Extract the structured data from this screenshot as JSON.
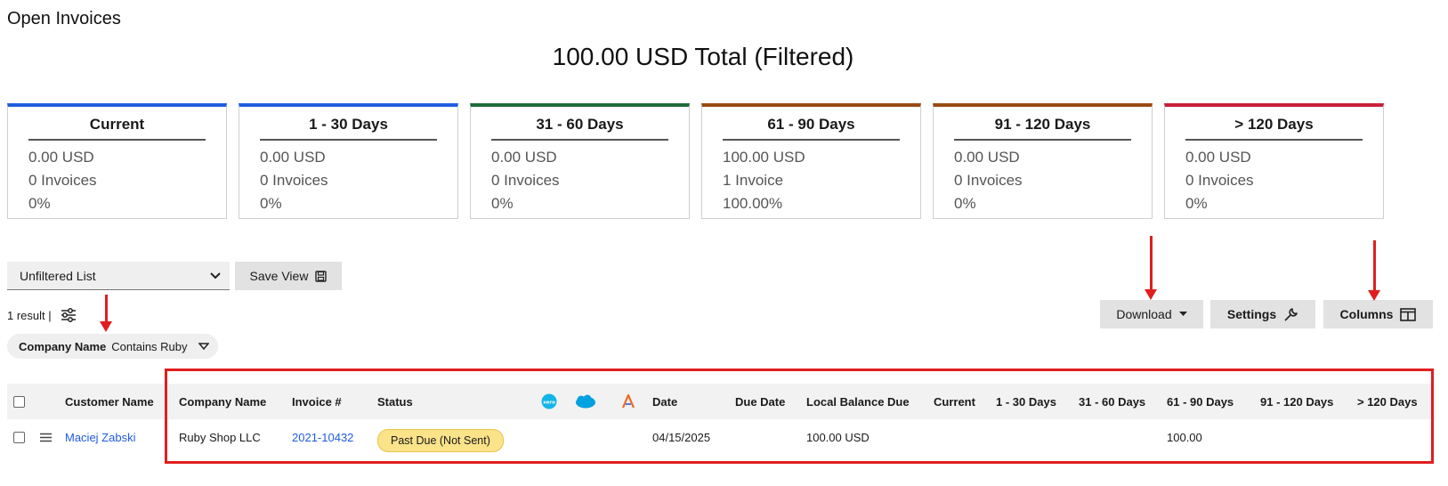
{
  "page": {
    "title": "Open Invoices",
    "total": "100.00 USD Total (Filtered)"
  },
  "buckets": [
    {
      "title": "Current",
      "amount": "0.00 USD",
      "count": "0 Invoices",
      "percent": "0%",
      "color": "#1f5ce0"
    },
    {
      "title": "1 - 30 Days",
      "amount": "0.00 USD",
      "count": "0 Invoices",
      "percent": "0%",
      "color": "#1f5ce0"
    },
    {
      "title": "31 - 60 Days",
      "amount": "0.00 USD",
      "count": "0 Invoices",
      "percent": "0%",
      "color": "#1e6b3a"
    },
    {
      "title": "61 - 90 Days",
      "amount": "100.00 USD",
      "count": "1 Invoice",
      "percent": "100.00%",
      "color": "#9a4a14"
    },
    {
      "title": "91 - 120 Days",
      "amount": "0.00 USD",
      "count": "0 Invoices",
      "percent": "0%",
      "color": "#9a4a14"
    },
    {
      "title": "> 120 Days",
      "amount": "0.00 USD",
      "count": "0 Invoices",
      "percent": "0%",
      "color": "#c8203a"
    }
  ],
  "controls": {
    "view_select": "Unfiltered List",
    "save_view": "Save View",
    "result_count": "1 result |",
    "download": "Download",
    "settings": "Settings",
    "columns": "Columns"
  },
  "filter": {
    "field": "Company Name",
    "condition": "Contains Ruby"
  },
  "table": {
    "headers": {
      "customer": "Customer Name",
      "company": "Company Name",
      "invoice": "Invoice #",
      "status": "Status",
      "date": "Date",
      "due": "Due Date",
      "balance": "Local Balance Due",
      "current": "Current",
      "d30": "1 - 30 Days",
      "d60": "31 - 60 Days",
      "d90": "61 - 90 Days",
      "d120": "91 - 120 Days",
      "over120": "> 120 Days"
    },
    "rows": [
      {
        "customer": "Maciej Zabski",
        "company": "Ruby Shop LLC",
        "invoice": "2021-10432",
        "status": "Past Due (Not Sent)",
        "date": "04/15/2025",
        "due": "",
        "balance": "100.00 USD",
        "current": "",
        "d30": "",
        "d60": "",
        "d90": "100.00",
        "d120": "",
        "over120": ""
      }
    ]
  },
  "icons": [
    "xero-icon",
    "salesforce-icon",
    "avalara-icon",
    "filter-sliders-icon",
    "save-icon",
    "wrench-icon",
    "columns-icon",
    "chevron-down-icon",
    "menu-icon"
  ],
  "colors": {
    "link": "#1f5ce0",
    "badge": "#fbe38a",
    "annotation": "#e01e1e"
  }
}
